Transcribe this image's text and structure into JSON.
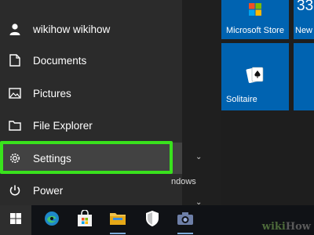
{
  "menu": {
    "user": "wikihow wikihow",
    "documents": "Documents",
    "pictures": "Pictures",
    "file_explorer": "File Explorer",
    "settings": "Settings",
    "power": "Power"
  },
  "middle": {
    "fragment_text": "ndows"
  },
  "tiles": {
    "microsoft_store": "Microsoft Store",
    "new_tile": "New",
    "solitaire": "Solitaire",
    "clock_partial": "33"
  },
  "watermark": {
    "wiki": "wiki",
    "how": "How"
  },
  "colors": {
    "accent": "#0063b1",
    "highlight": "#39e21d",
    "taskbar": "#101216"
  }
}
